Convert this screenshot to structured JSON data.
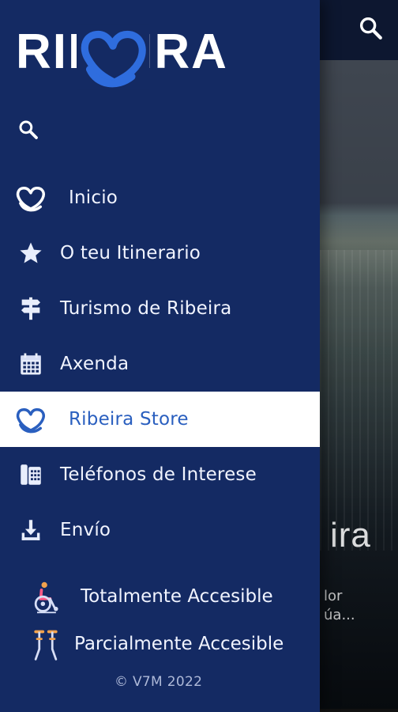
{
  "app": {
    "brand": "RIBEIRA"
  },
  "drawer": {
    "menu": [
      {
        "label": "Inicio",
        "icon": "heart-icon"
      },
      {
        "label": "O teu Itinerario",
        "icon": "star-icon"
      },
      {
        "label": "Turismo de Ribeira",
        "icon": "signpost-icon"
      },
      {
        "label": "Axenda",
        "icon": "calendar-icon"
      },
      {
        "label": "Ribeira Store",
        "icon": "heart-icon",
        "selected": true
      },
      {
        "label": "Teléfonos de Interese",
        "icon": "phone-icon"
      },
      {
        "label": "Envío",
        "icon": "download-icon"
      }
    ],
    "accessibility": [
      {
        "label": "Totalmente Accesible",
        "icon": "wheelchair-icon"
      },
      {
        "label": "Parcialmente Accesible",
        "icon": "crutches-icon"
      }
    ],
    "footer": "© V7M 2022"
  },
  "background": {
    "title_fragment": "ira",
    "subtitle_lines": [
      "lor",
      "úa..."
    ]
  },
  "colors": {
    "drawer": "#142a63",
    "active_bg": "#ffffff",
    "active_text": "#2a5fbf",
    "brand_heart": "#2f6dde"
  }
}
